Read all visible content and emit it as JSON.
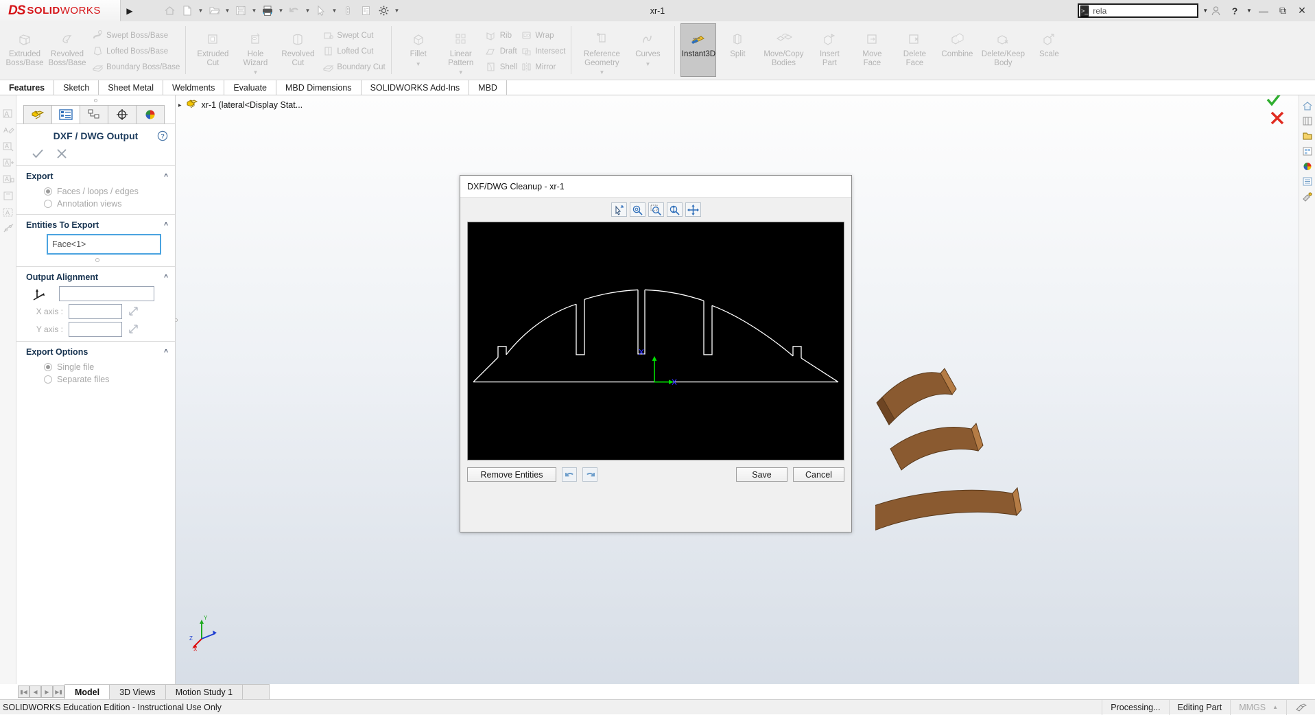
{
  "app": {
    "brand_mark": "DS",
    "brand_name_bold": "SOLID",
    "brand_name_light": "WORKS",
    "document_title": "xr-1",
    "accent_red": "#d51317",
    "accent_blue": "#4aa3e0"
  },
  "titlebar": {
    "expand_arrow": "▶",
    "quick_access": [
      {
        "name": "home-icon",
        "caret": false
      },
      {
        "name": "new-document-icon",
        "caret": true
      },
      {
        "name": "open-folder-icon",
        "caret": true
      },
      {
        "name": "save-icon",
        "caret": true
      },
      {
        "name": "print-icon",
        "caret": true
      },
      {
        "name": "undo-icon",
        "caret": true
      },
      {
        "name": "select-pointer-icon",
        "caret": true
      },
      {
        "name": "rebuild-icon",
        "caret": false
      },
      {
        "name": "file-properties-icon",
        "caret": false
      },
      {
        "name": "options-gear-icon",
        "caret": true
      }
    ],
    "search": {
      "value": "rela",
      "placeholder": "Search"
    },
    "window_controls": [
      "user-icon",
      "help-icon",
      "help-caret",
      "minimize",
      "restore",
      "close"
    ]
  },
  "ribbon": {
    "groups": [
      {
        "name": "boss-base-group",
        "big": [
          {
            "label": "Extruded\nBoss/Base",
            "icon": "extruded-boss-icon"
          },
          {
            "label": "Revolved\nBoss/Base",
            "icon": "revolved-boss-icon"
          }
        ],
        "small": [
          {
            "label": "Swept Boss/Base",
            "icon": "swept-boss-icon"
          },
          {
            "label": "Lofted Boss/Base",
            "icon": "lofted-boss-icon"
          },
          {
            "label": "Boundary Boss/Base",
            "icon": "boundary-boss-icon"
          }
        ]
      },
      {
        "name": "cut-group",
        "big": [
          {
            "label": "Extruded\nCut",
            "icon": "extruded-cut-icon"
          },
          {
            "label": "Hole\nWizard",
            "icon": "hole-wizard-icon",
            "caret": true
          },
          {
            "label": "Revolved\nCut",
            "icon": "revolved-cut-icon"
          }
        ],
        "small": [
          {
            "label": "Swept Cut",
            "icon": "swept-cut-icon"
          },
          {
            "label": "Lofted Cut",
            "icon": "lofted-cut-icon"
          },
          {
            "label": "Boundary Cut",
            "icon": "boundary-cut-icon"
          }
        ]
      },
      {
        "name": "feature-group",
        "big": [
          {
            "label": "Fillet",
            "icon": "fillet-icon",
            "caret": true
          },
          {
            "label": "Linear\nPattern",
            "icon": "linear-pattern-icon",
            "caret": true
          }
        ],
        "small": [
          {
            "label": "Rib",
            "icon": "rib-icon"
          },
          {
            "label": "Draft",
            "icon": "draft-icon"
          },
          {
            "label": "Shell",
            "icon": "shell-icon"
          }
        ],
        "small2": [
          {
            "label": "Wrap",
            "icon": "wrap-icon"
          },
          {
            "label": "Intersect",
            "icon": "intersect-icon"
          },
          {
            "label": "Mirror",
            "icon": "mirror-icon"
          }
        ]
      },
      {
        "name": "reference-group",
        "big": [
          {
            "label": "Reference\nGeometry",
            "icon": "reference-geometry-icon",
            "caret": true
          },
          {
            "label": "Curves",
            "icon": "curves-icon",
            "caret": true
          }
        ]
      },
      {
        "name": "direct-editing-group",
        "big": [
          {
            "label": "Instant3D",
            "icon": "instant3d-icon",
            "active": true
          },
          {
            "label": "Split",
            "icon": "split-icon"
          },
          {
            "label": "Move/Copy\nBodies",
            "icon": "move-copy-bodies-icon"
          },
          {
            "label": "Insert\nPart",
            "icon": "insert-part-icon"
          },
          {
            "label": "Move\nFace",
            "icon": "move-face-icon"
          },
          {
            "label": "Delete\nFace",
            "icon": "delete-face-icon"
          },
          {
            "label": "Combine",
            "icon": "combine-icon"
          },
          {
            "label": "Delete/Keep\nBody",
            "icon": "delete-keep-body-icon"
          },
          {
            "label": "Scale",
            "icon": "scale-icon"
          }
        ]
      }
    ]
  },
  "command_tabs": [
    {
      "label": "Features",
      "selected": true
    },
    {
      "label": "Sketch",
      "selected": false
    },
    {
      "label": "Sheet Metal",
      "selected": false
    },
    {
      "label": "Weldments",
      "selected": false
    },
    {
      "label": "Evaluate",
      "selected": false
    },
    {
      "label": "MBD Dimensions",
      "selected": false
    },
    {
      "label": "SOLIDWORKS Add-Ins",
      "selected": false
    },
    {
      "label": "MBD",
      "selected": false
    }
  ],
  "left_rail_icons": [
    "annotation-note-icon",
    "annotation-edit-icon",
    "annotation-move-icon",
    "annotation-add-icon",
    "annotation-lock-icon",
    "annotation-save-icon",
    "annotation-area-icon",
    "annotation-link-icon"
  ],
  "property_manager": {
    "tabs": [
      {
        "name": "feature-manager-tab",
        "icon": "yellow-part-icon",
        "selected": false
      },
      {
        "name": "property-manager-tab",
        "icon": "property-list-icon",
        "selected": true
      },
      {
        "name": "configuration-manager-tab",
        "icon": "configuration-icon",
        "selected": false
      },
      {
        "name": "dimxpert-manager-tab",
        "icon": "dimxpert-icon",
        "selected": false
      },
      {
        "name": "display-manager-tab",
        "icon": "appearance-sphere-icon",
        "selected": false
      }
    ],
    "title": "DXF / DWG Output",
    "help_icon": "help-circle-icon",
    "ok_icon": "check-icon",
    "cancel_icon": "x-icon",
    "sections": {
      "export": {
        "title": "Export",
        "options": [
          {
            "label": "Faces / loops / edges",
            "selected": true
          },
          {
            "label": "Annotation views",
            "selected": false
          }
        ]
      },
      "entities_to_export": {
        "title": "Entities To Export",
        "selection_value": "Face<1>"
      },
      "output_alignment": {
        "title": "Output Alignment",
        "origin_icon": "origin-triad-icon",
        "origin_value": "",
        "x_axis_label": "X axis :",
        "x_axis_value": "",
        "y_axis_label": "Y axis :",
        "y_axis_value": "",
        "flip_icon": "reverse-direction-icon"
      },
      "export_options": {
        "title": "Export Options",
        "options": [
          {
            "label": "Single file",
            "selected": true
          },
          {
            "label": "Separate files",
            "selected": false
          }
        ]
      }
    }
  },
  "feature_tree": {
    "expand_arrow": "▸",
    "root_icon": "part-icon",
    "root_label": "xr-1  (lateral<Display Stat..."
  },
  "view_toolbar": [
    {
      "name": "zoom-to-fit-icon",
      "caret": false
    },
    {
      "name": "zoom-to-area-icon",
      "caret": false
    },
    {
      "name": "previous-view-icon",
      "caret": false
    },
    {
      "name": "section-view-icon",
      "caret": false
    },
    {
      "name": "view-orientation-icon",
      "caret": false
    },
    {
      "name": "display-style-icon",
      "caret": true
    },
    {
      "name": "hide-show-items-icon",
      "caret": true
    },
    {
      "name": "edit-appearance-icon",
      "caret": false
    },
    {
      "name": "apply-scene-icon",
      "caret": true
    },
    {
      "name": "view-settings-icon",
      "caret": true
    }
  ],
  "task_pane_icons": [
    "sw-resources-icon",
    "design-library-icon",
    "file-explorer-icon",
    "view-palette-icon",
    "appearances-icon",
    "custom-properties-icon",
    "render-tools-icon"
  ],
  "dialog": {
    "title": "DXF/DWG Cleanup - xr-1",
    "toolbar": [
      {
        "name": "select-entities-icon"
      },
      {
        "name": "zoom-in-out-icon"
      },
      {
        "name": "zoom-to-area-icon"
      },
      {
        "name": "zoom-to-fit-icon"
      },
      {
        "name": "pan-icon"
      }
    ],
    "buttons": {
      "remove_entities": "Remove Entities",
      "undo_icon": "undo-icon",
      "redo_icon": "redo-icon",
      "save": "Save",
      "cancel": "Cancel"
    },
    "preview": {
      "background": "#000000",
      "line_color": "#ffffff",
      "origin_x_axis_color": "#00ff00",
      "origin_y_axis_color": "#00ff00",
      "origin_marker_color": "#2222ff",
      "description": "Arched lateral profile outline with five vertical slots and origin triad"
    }
  },
  "bottom_tabs": {
    "nav_buttons": [
      "first",
      "previous",
      "next",
      "last"
    ],
    "tabs": [
      {
        "label": "Model",
        "selected": true
      },
      {
        "label": "3D Views",
        "selected": false
      },
      {
        "label": "Motion Study 1",
        "selected": false
      }
    ]
  },
  "status_bar": {
    "left": "SOLIDWORKS Education Edition - Instructional Use Only",
    "processing": "Processing...",
    "mode": "Editing Part",
    "units": "MMGS",
    "units_caret": "▲",
    "overlay_icon": "overlay-icon"
  }
}
